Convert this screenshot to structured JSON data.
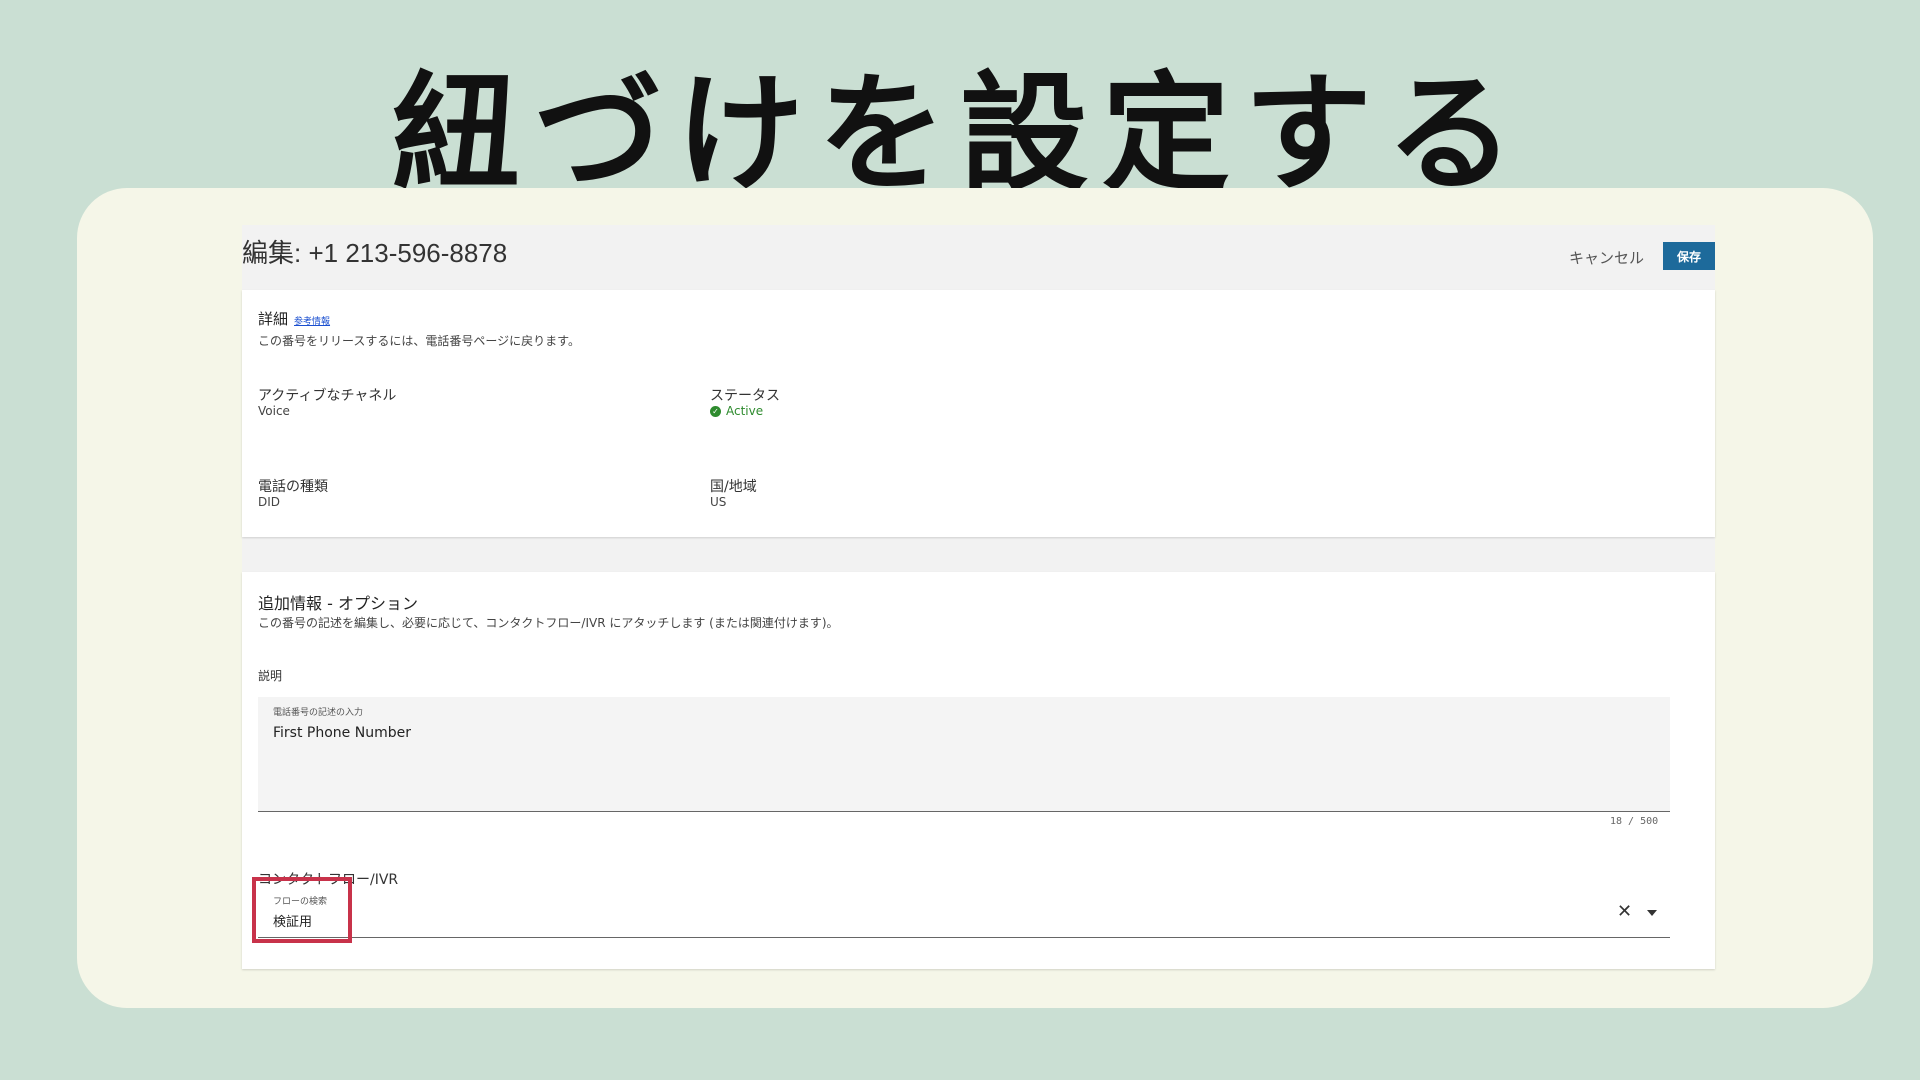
{
  "headline": "紐づけを設定する",
  "header": {
    "title": "編集: +1 213-596-8878",
    "cancel_label": "キャンセル",
    "save_label": "保存"
  },
  "details": {
    "title": "詳細",
    "ref_link": "参考情報",
    "description": "この番号をリリースするには、電話番号ページに戻ります。",
    "fields": {
      "active_channel": {
        "label": "アクティブなチャネル",
        "value": "Voice"
      },
      "status": {
        "label": "ステータス",
        "value": "Active"
      },
      "phone_type": {
        "label": "電話の種類",
        "value": "DID"
      },
      "country": {
        "label": "国/地域",
        "value": "US"
      }
    }
  },
  "additional": {
    "title": "追加情報 - オプション",
    "description": "この番号の記述を編集し、必要に応じて、コンタクトフロー/IVR にアタッチします (または関連付けます)。",
    "desc_label": "説明",
    "textarea_label": "電話番号の記述の入力",
    "textarea_value": "First Phone Number",
    "counter": "18 / 500",
    "flow_label": "コンタクトフロー/IVR",
    "flow_sublabel": "フローの検索",
    "flow_value": "検証用"
  },
  "colors": {
    "background": "#cadfd3",
    "card": "#f5f6e8",
    "save_button": "#1d6a9b",
    "active_status": "#2e8b2e",
    "highlight": "#c8324a"
  }
}
